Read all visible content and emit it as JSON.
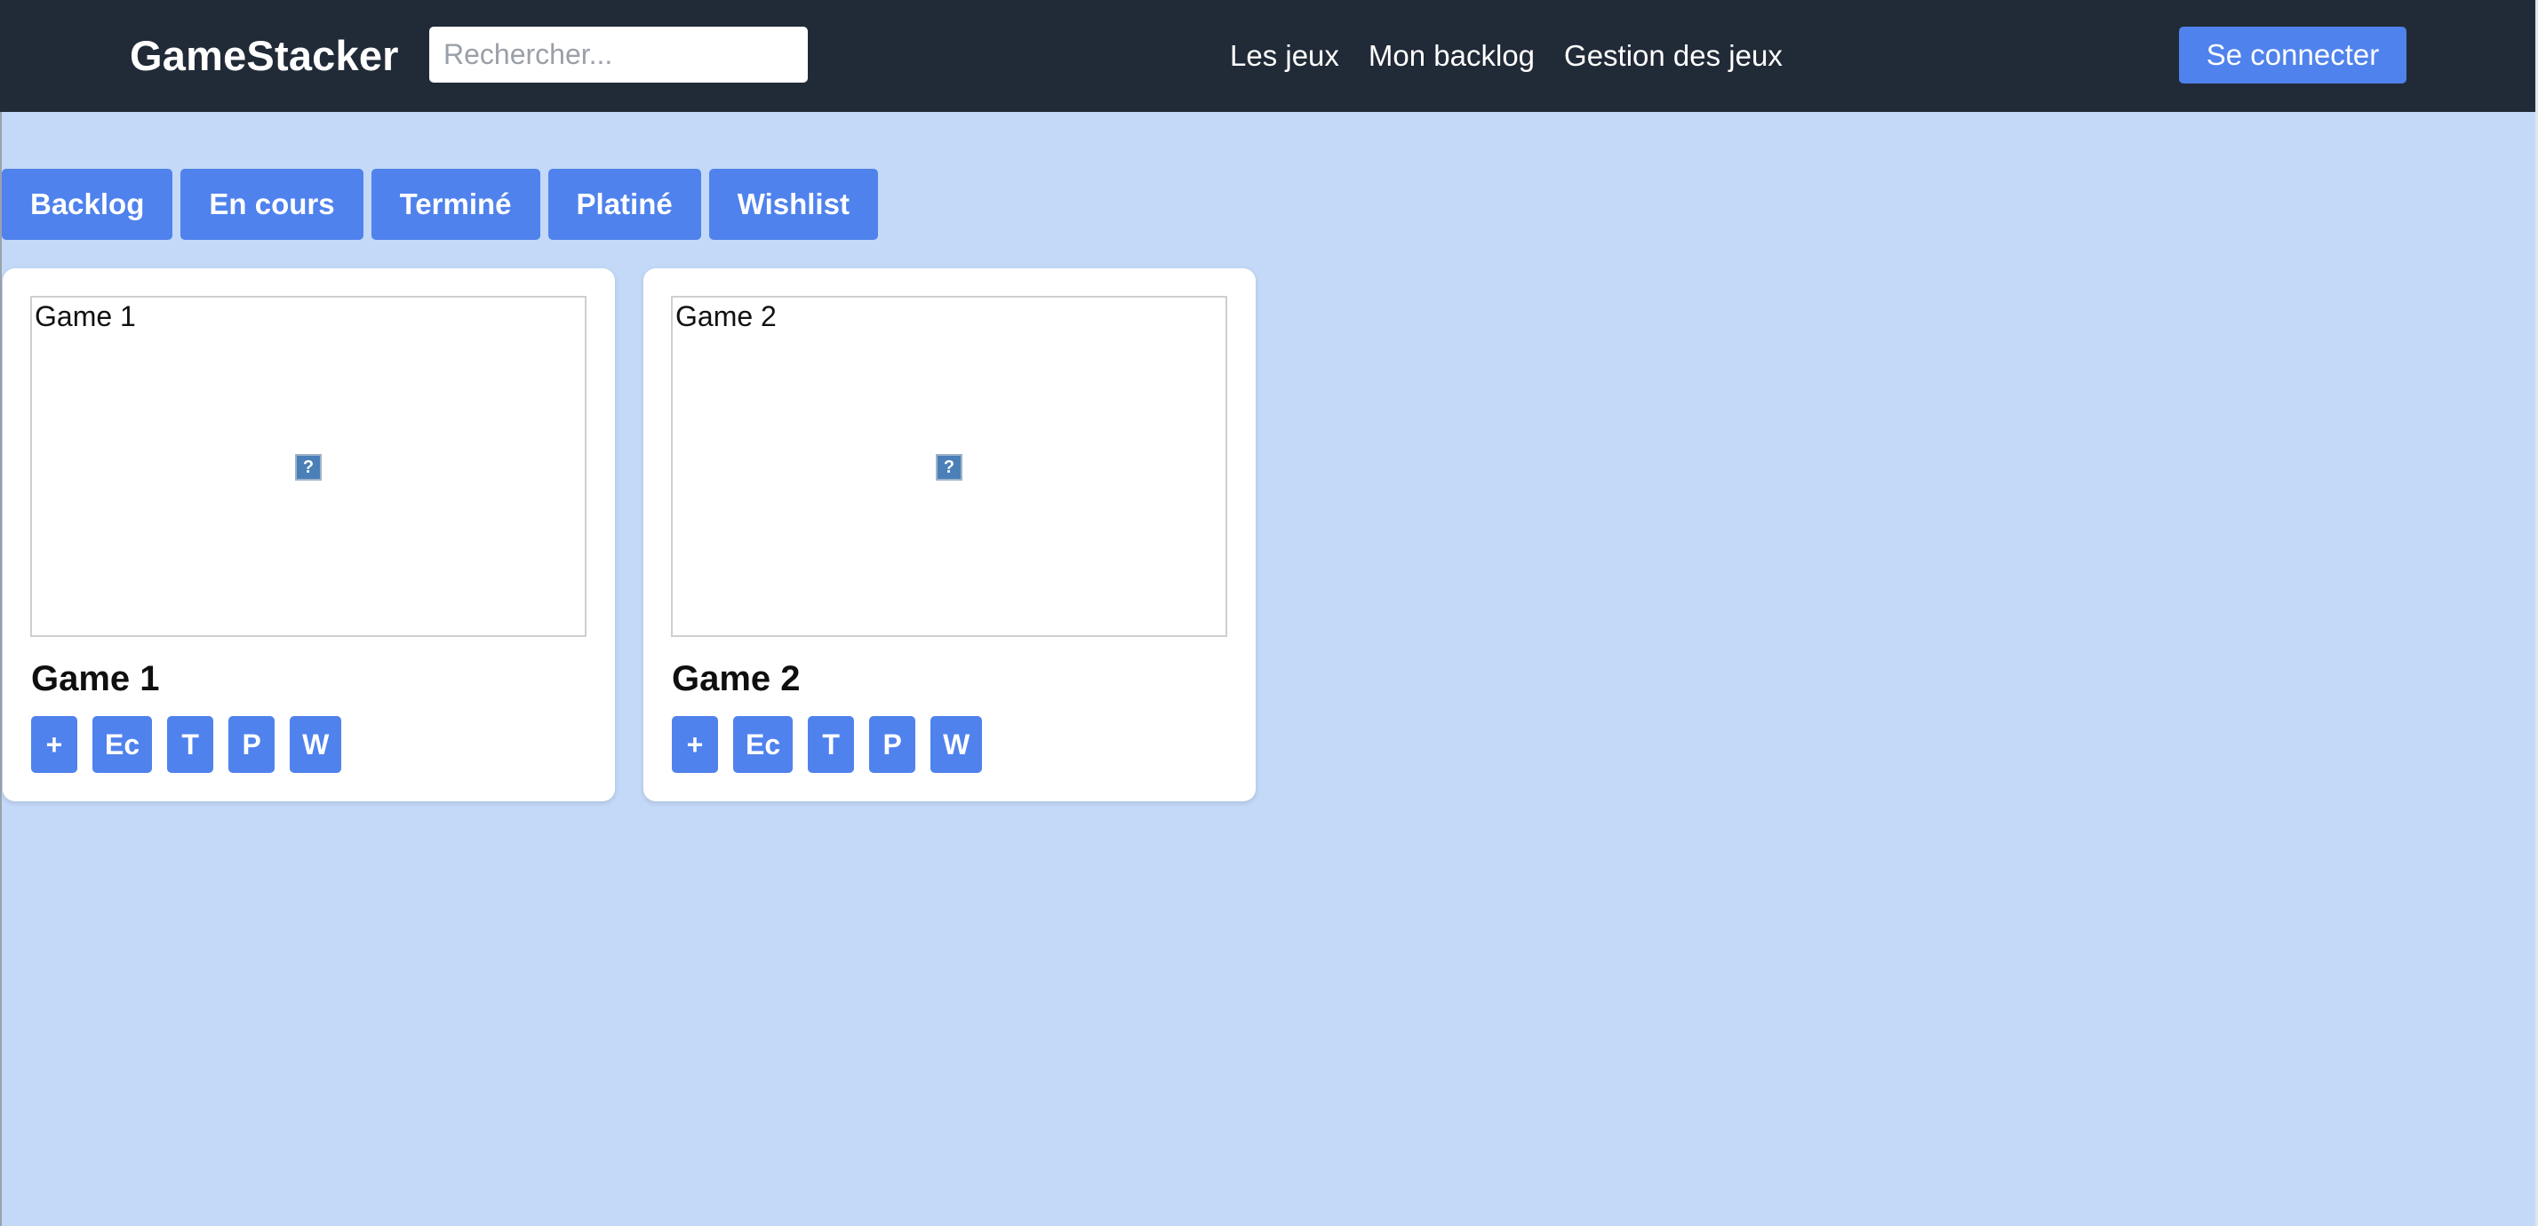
{
  "header": {
    "brand": "GameStacker",
    "search_placeholder": "Rechercher...",
    "nav": [
      {
        "label": "Les jeux"
      },
      {
        "label": "Mon backlog"
      },
      {
        "label": "Gestion des jeux"
      }
    ],
    "login_label": "Se connecter"
  },
  "tabs": [
    {
      "label": "Backlog"
    },
    {
      "label": "En cours"
    },
    {
      "label": "Terminé"
    },
    {
      "label": "Platiné"
    },
    {
      "label": "Wishlist"
    }
  ],
  "games": [
    {
      "image_alt": "Game 1",
      "title": "Game 1",
      "actions": [
        "+",
        "Ec",
        "T",
        "P",
        "W"
      ]
    },
    {
      "image_alt": "Game 2",
      "title": "Game 2",
      "actions": [
        "+",
        "Ec",
        "T",
        "P",
        "W"
      ]
    }
  ],
  "colors": {
    "navbar_bg": "#212a37",
    "page_bg": "#c3d9f7",
    "accent": "#4f82ec",
    "card_bg": "#ffffff"
  },
  "icons": {
    "broken_image": "broken-image-icon"
  }
}
